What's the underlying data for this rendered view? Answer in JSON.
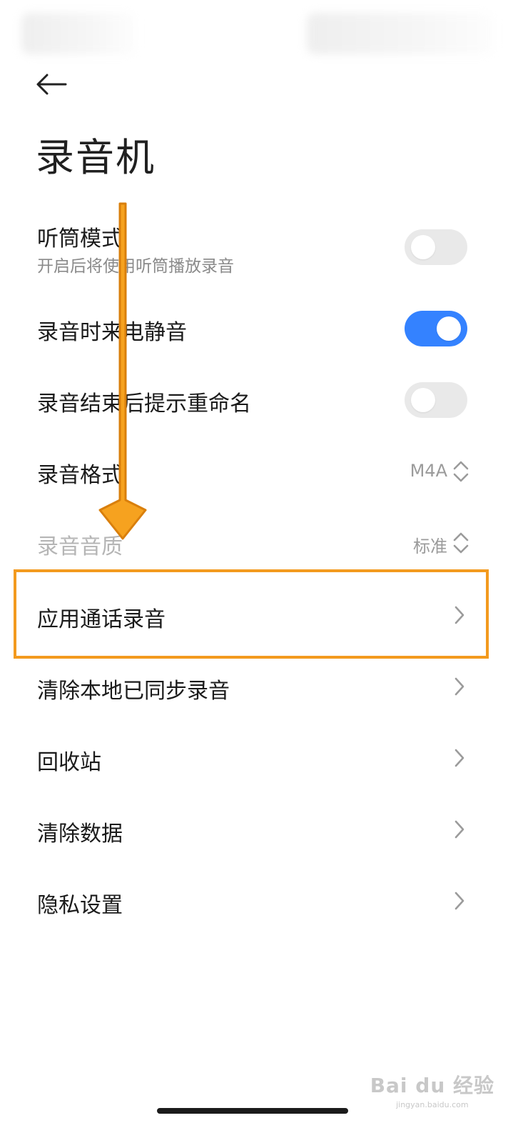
{
  "app": {
    "title": "录音机"
  },
  "settings": [
    {
      "label": "听筒模式",
      "subtitle": "开启后将使用听筒播放录音",
      "control": "toggle",
      "on": false
    },
    {
      "label": "录音时来电静音",
      "control": "toggle",
      "on": true
    },
    {
      "label": "录音结束后提示重命名",
      "control": "toggle",
      "on": false
    },
    {
      "label": "录音格式",
      "control": "select",
      "value": "M4A"
    },
    {
      "label": "录音音质",
      "control": "select",
      "value": "标准",
      "disabled": true
    },
    {
      "label": "应用通话录音",
      "control": "link",
      "highlighted": true
    },
    {
      "label": "清除本地已同步录音",
      "control": "link"
    },
    {
      "label": "回收站",
      "control": "link"
    },
    {
      "label": "清除数据",
      "control": "link"
    },
    {
      "label": "隐私设置",
      "control": "link"
    }
  ],
  "annotation": {
    "arrow_color": "#f39a1e",
    "box_color": "#f39a1e"
  },
  "colors": {
    "accent": "#3482ff",
    "toggle_off": "#e9e9e9"
  },
  "watermark": {
    "main": "Bai du 经验",
    "sub": "jingyan.baidu.com"
  }
}
